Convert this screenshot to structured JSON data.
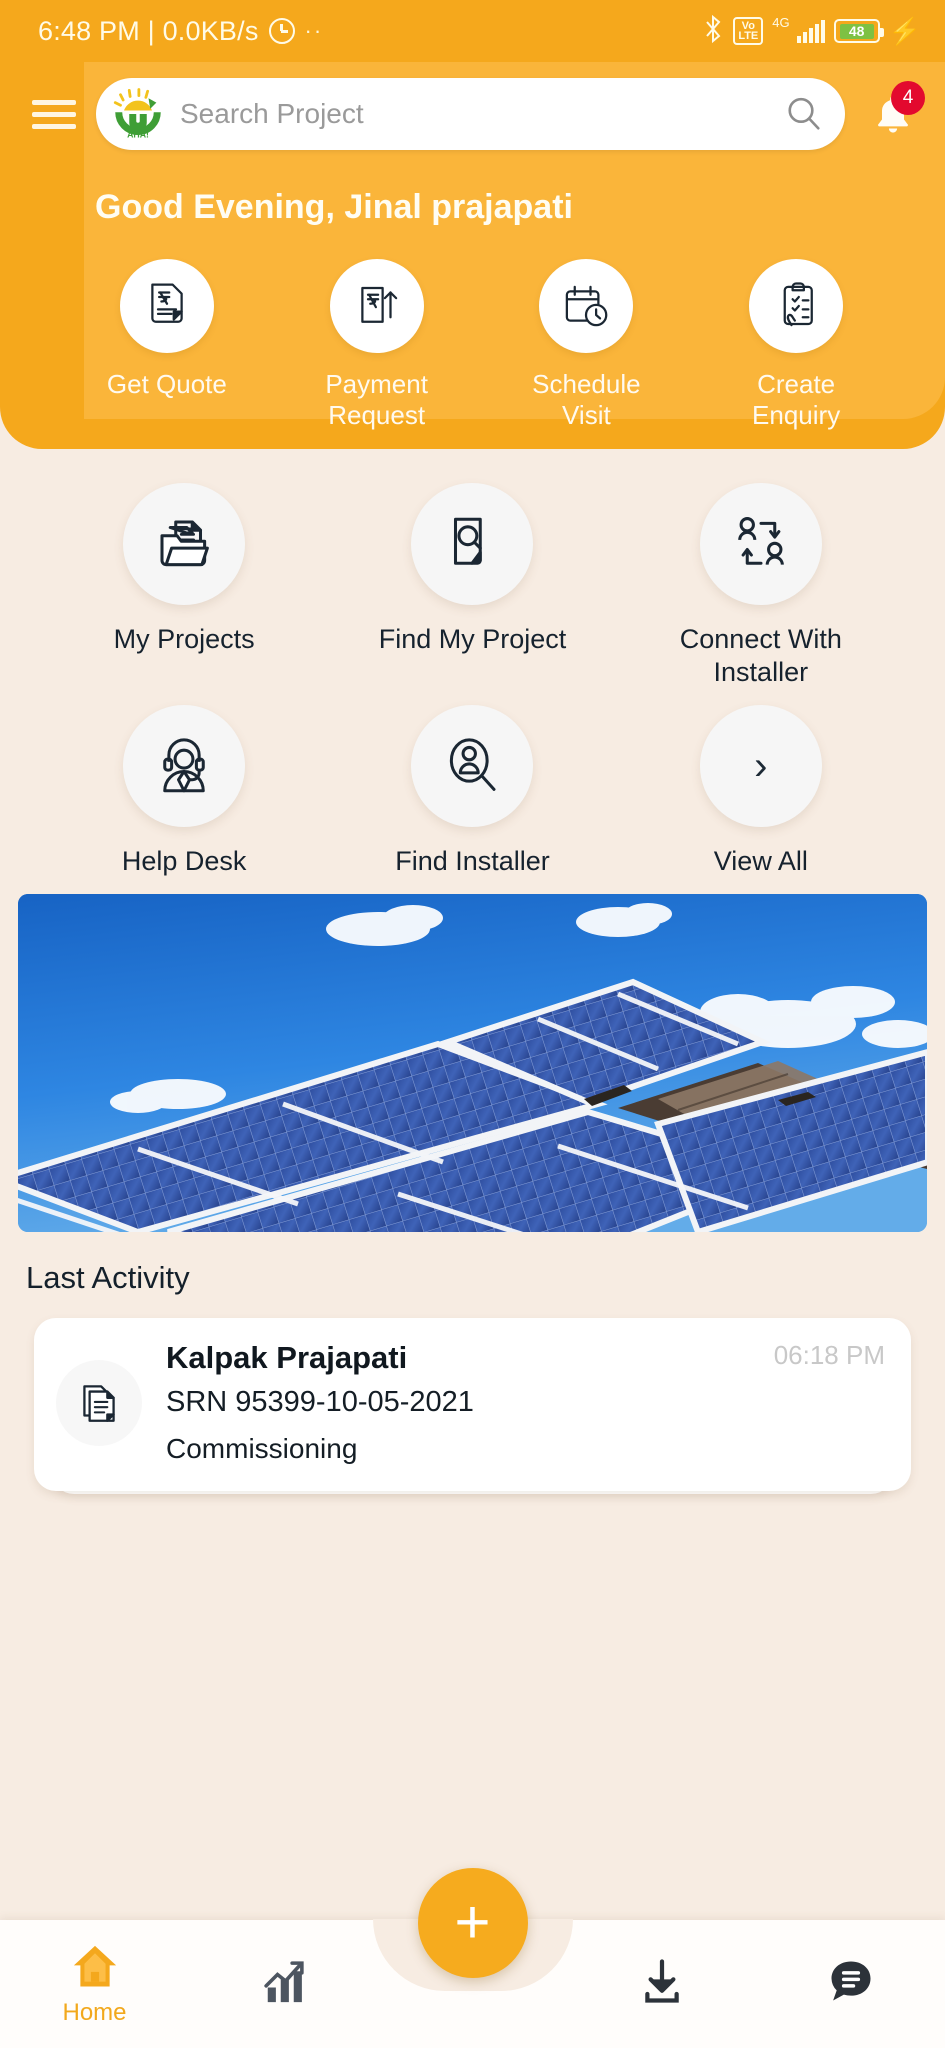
{
  "statusbar": {
    "time_and_speed": "6:48 PM | 0.0KB/s",
    "alarm_icon": "alarm-icon",
    "more_dots": "··",
    "bluetooth_icon": "bluetooth-icon",
    "volte_top": "Vo",
    "volte_bottom": "LTE",
    "network_type": "4G",
    "signal_icon": "signal-bars-icon",
    "battery_percent": "48",
    "charging_icon": "charging-bolt-icon"
  },
  "header": {
    "menu_icon": "hamburger-menu-icon",
    "logo_text": "AHA!",
    "search_placeholder": "Search Project",
    "search_value": "",
    "search_icon": "search-icon",
    "bell_icon": "notification-bell-icon",
    "notification_count": "4",
    "greeting": "Good Evening, Jinal prajapati",
    "brand_color": "#f5a81c",
    "panel_color": "#fab53a",
    "badge_color": "#e3092e"
  },
  "quick_actions": [
    {
      "label": "Get Quote",
      "icon": "rupee-document-icon"
    },
    {
      "label": "Payment\nRequest",
      "icon": "rupee-upload-icon"
    },
    {
      "label": "Schedule Visit",
      "icon": "calendar-clock-icon"
    },
    {
      "label": "Create\nEnquiry",
      "icon": "clipboard-checklist-icon"
    }
  ],
  "grid": {
    "row1": [
      {
        "label": "My Projects",
        "icon": "folder-documents-icon"
      },
      {
        "label": "Find My Project",
        "icon": "document-search-icon"
      },
      {
        "label": "Connect With Installer",
        "icon": "people-connect-icon"
      }
    ],
    "row2": [
      {
        "label": "Help Desk",
        "icon": "headset-agent-icon"
      },
      {
        "label": "Find Installer",
        "icon": "person-search-icon"
      },
      {
        "label": "View All",
        "icon": "chevron-right-icon",
        "glyph": "›"
      }
    ]
  },
  "hero": {
    "alt": "solar-panels-on-roof-photo"
  },
  "last_activity": {
    "section_title": "Last Activity",
    "items": [
      {
        "icon": "documents-icon",
        "name": "Kalpak  Prajapati",
        "time": "06:18 PM",
        "srn": "SRN 95399-10-05-2021",
        "stage": "Commissioning"
      }
    ]
  },
  "bottom_nav": {
    "items": [
      {
        "label": "Home",
        "icon": "home-icon",
        "active": true
      },
      {
        "label": "",
        "icon": "analytics-chart-icon",
        "active": false
      },
      {
        "label": "",
        "icon": "download-icon",
        "active": false
      },
      {
        "label": "",
        "icon": "chat-bubble-icon",
        "active": false
      }
    ],
    "fab": {
      "label": "+",
      "icon": "add-icon",
      "color": "#f6ab1e"
    },
    "active_color": "#f2a81c"
  }
}
